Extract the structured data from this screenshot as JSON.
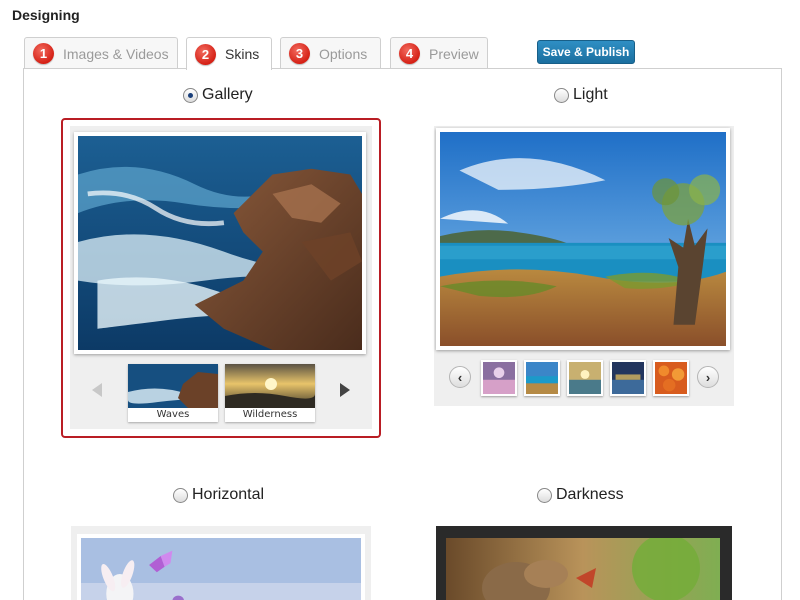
{
  "page": {
    "heading": "Designing"
  },
  "tabs": [
    {
      "number": "1",
      "label": "Images & Videos",
      "active": false
    },
    {
      "number": "2",
      "label": "Skins",
      "active": true
    },
    {
      "number": "3",
      "label": "Options",
      "active": false
    },
    {
      "number": "4",
      "label": "Preview",
      "active": false
    }
  ],
  "toolbar": {
    "publish_label": "Save & Publish"
  },
  "skins": [
    {
      "label": "Gallery",
      "selected": true
    },
    {
      "label": "Light",
      "selected": false
    },
    {
      "label": "Horizontal",
      "selected": false
    },
    {
      "label": "Darkness",
      "selected": false
    }
  ],
  "gallery_preview": {
    "thumbnails": [
      {
        "caption": "Waves"
      },
      {
        "caption": "Wilderness"
      }
    ]
  },
  "colors": {
    "selected_border": "#b91d24",
    "publish_button": "#2a83b8",
    "tab_badge": "#d52116"
  }
}
